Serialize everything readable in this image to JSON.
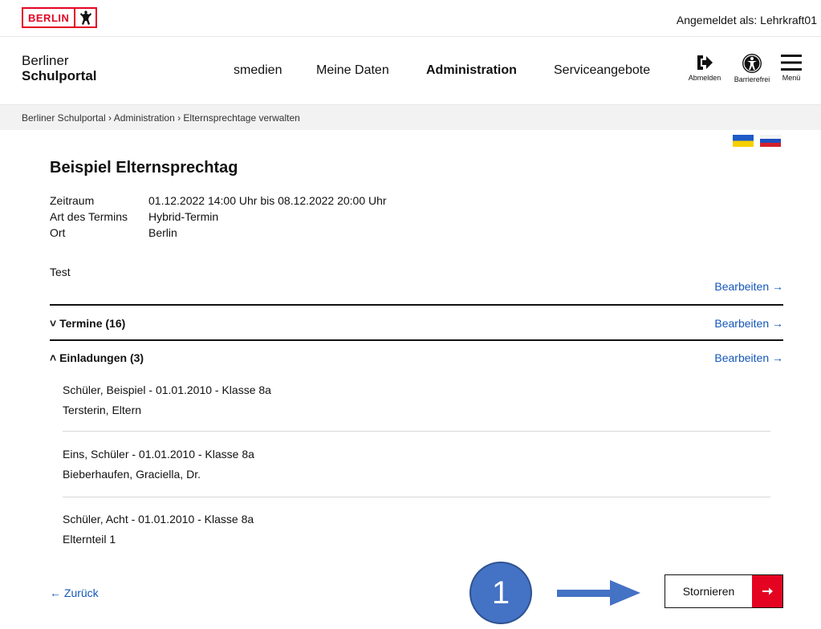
{
  "topbar": {
    "logo_text": "BERLIN",
    "login_status": "Angemeldet als: Lehrkraft01"
  },
  "header": {
    "brand_line1": "Berliner",
    "brand_line2": "Schulportal",
    "nav": [
      {
        "label": "smedien"
      },
      {
        "label": "Meine Daten"
      },
      {
        "label": "Administration"
      },
      {
        "label": "Serviceangebote"
      }
    ],
    "icons": {
      "logout_label": "Abmelden",
      "accessibility_label": "Barrierefrei",
      "menu_label": "Menü"
    }
  },
  "breadcrumb": "Berliner Schulportal › Administration › Elternsprechtage verwalten",
  "event": {
    "title": "Beispiel Elternsprechtag",
    "fields": [
      {
        "key": "Zeitraum",
        "value": "01.12.2022 14:00 Uhr bis 08.12.2022 20:00 Uhr"
      },
      {
        "key": "Art des Termins",
        "value": "Hybrid-Termin"
      },
      {
        "key": "Ort",
        "value": "Berlin"
      }
    ],
    "description": "Test",
    "edit_label": "Bearbeiten →"
  },
  "sections": {
    "termine": {
      "title": "˅ Termine (16)",
      "edit_label": "Bearbeiten →"
    },
    "einladungen": {
      "title": "˄ Einladungen (3)",
      "edit_label": "Bearbeiten →"
    }
  },
  "invitations": [
    {
      "student": "Schüler, Beispiel - 01.01.2010 - Klasse 8a",
      "guardian": "Tersterin, Eltern"
    },
    {
      "student": "Eins, Schüler - 01.01.2010 - Klasse 8a",
      "guardian": "Bieberhaufen, Graciella, Dr."
    },
    {
      "student": "Schüler, Acht - 01.01.2010 - Klasse 8a",
      "guardian": "Elternteil 1"
    }
  ],
  "footer": {
    "back_label": "← Zurück",
    "cancel_label": "Stornieren"
  },
  "annotation": {
    "step_number": "1",
    "circle_color": "#4472c4"
  },
  "colors": {
    "accent_red": "#e40422",
    "link_blue": "#1457b8"
  }
}
